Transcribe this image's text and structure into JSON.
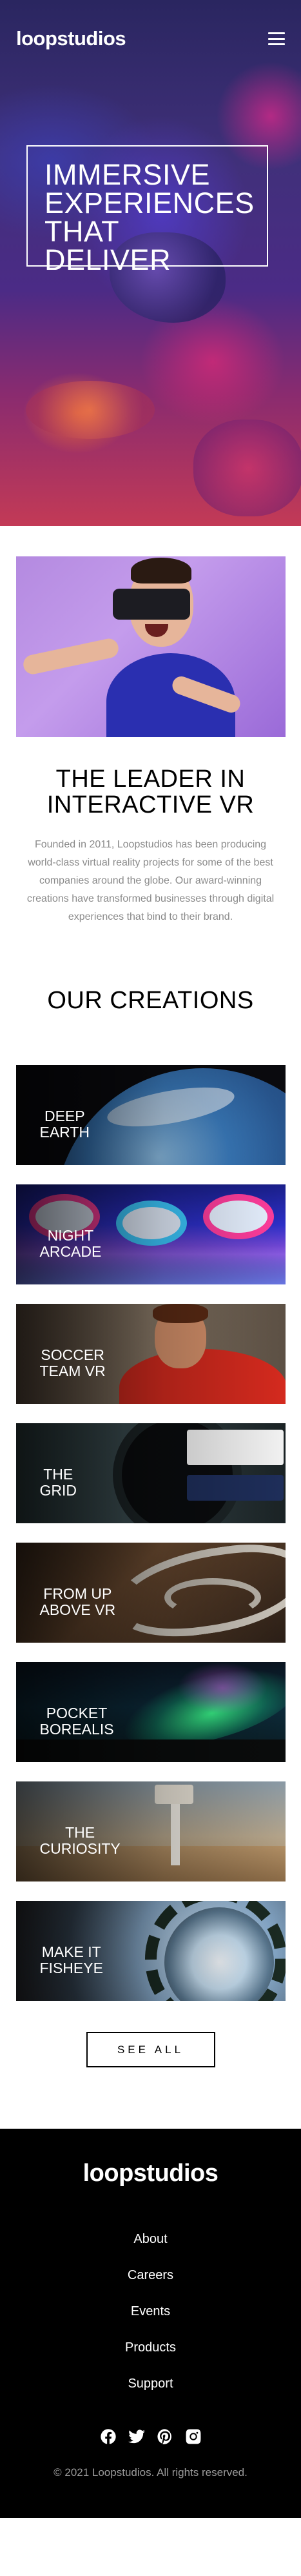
{
  "header": {
    "logo": "loopstudios",
    "menu_icon": "hamburger-menu-icon"
  },
  "hero": {
    "title": "Immersive experiences that deliver"
  },
  "about": {
    "title": "The leader in interactive VR",
    "text": "Founded in 2011, Loopstudios has been producing world-class virtual reality projects for some of the best companies around the globe. Our award-winning creations have transformed businesses through digital experiences that bind to their brand."
  },
  "creations": {
    "title": "Our creations",
    "items": [
      {
        "label": "Deep\nEarth"
      },
      {
        "label": "Night\nArcade"
      },
      {
        "label": "Soccer\nTeam VR"
      },
      {
        "label": "The\nGrid"
      },
      {
        "label": "From up\nabove VR"
      },
      {
        "label": "Pocket\nBorealis"
      },
      {
        "label": "The\nCuriosity"
      },
      {
        "label": "Make it\nfisheye"
      }
    ],
    "see_all": "See all"
  },
  "footer": {
    "logo": "loopstudios",
    "nav": [
      "About",
      "Careers",
      "Events",
      "Products",
      "Support"
    ],
    "socials": [
      "facebook-icon",
      "twitter-icon",
      "pinterest-icon",
      "instagram-icon"
    ],
    "copyright": "© 2021 Loopstudios. All rights reserved."
  }
}
